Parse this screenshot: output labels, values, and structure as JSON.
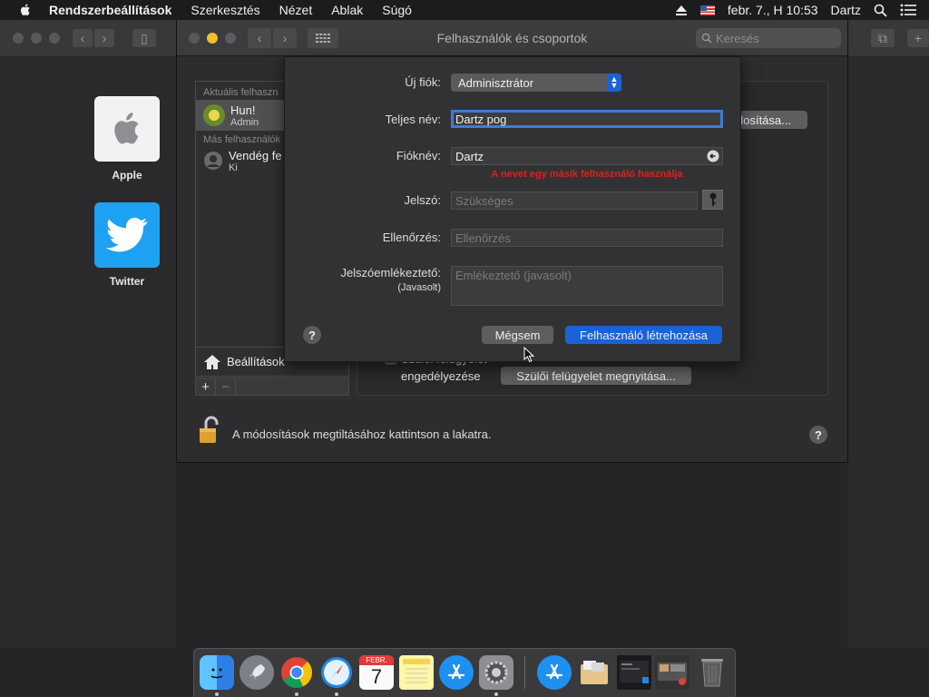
{
  "menubar": {
    "app_name": "Rendszerbeállítások",
    "items": [
      "Szerkesztés",
      "Nézet",
      "Ablak",
      "Súgó"
    ],
    "datetime": "febr. 7., H  10:53",
    "user": "Dartz"
  },
  "desktop": {
    "icons": [
      {
        "label": "Apple"
      },
      {
        "label": "Twitter"
      }
    ]
  },
  "window": {
    "title": "Felhasználók és csoportok",
    "search_placeholder": "Keresés"
  },
  "sidebar": {
    "current_header": "Aktuális felhaszn",
    "current_user": {
      "name": "Hun!",
      "role": "Admin"
    },
    "other_header": "Más felhasználók",
    "other_user": {
      "name": "Vendég fe",
      "role": "Ki"
    },
    "settings_label": "Beállítások",
    "add_label": "+",
    "remove_label": "−"
  },
  "content": {
    "modify_button": "dosítása...",
    "parental_checkbox_line1": "Szülői felügyelet",
    "parental_checkbox_line2": "engedélyezése",
    "parental_button": "Szülői felügyelet megnyitása...",
    "lock_text": "A módosítások megtiltásához kattintson a lakatra.",
    "help": "?"
  },
  "sheet": {
    "new_account_label": "Új fiók:",
    "new_account_value": "Adminisztrátor",
    "full_name_label": "Teljes név:",
    "full_name_value": "Dartz pog",
    "account_name_label": "Fióknév:",
    "account_name_value": "Dartz",
    "error_message": "A nevet egy másik felhasználó használja",
    "password_label": "Jelszó:",
    "password_placeholder": "Szükséges",
    "verify_label": "Ellenőrzés:",
    "verify_placeholder": "Ellenőrzés",
    "hint_label": "Jelszóemlékeztető:",
    "hint_sublabel": "(Javasolt)",
    "hint_placeholder": "Emlékeztető (javasolt)",
    "cancel_button": "Mégsem",
    "create_button": "Felhasználó létrehozása",
    "help": "?"
  },
  "dock": {
    "calendar_month": "FEBR.",
    "calendar_day": "7"
  },
  "colors": {
    "accent": "#1a63d6",
    "error": "#e0201a",
    "twitter": "#1da1f2"
  }
}
